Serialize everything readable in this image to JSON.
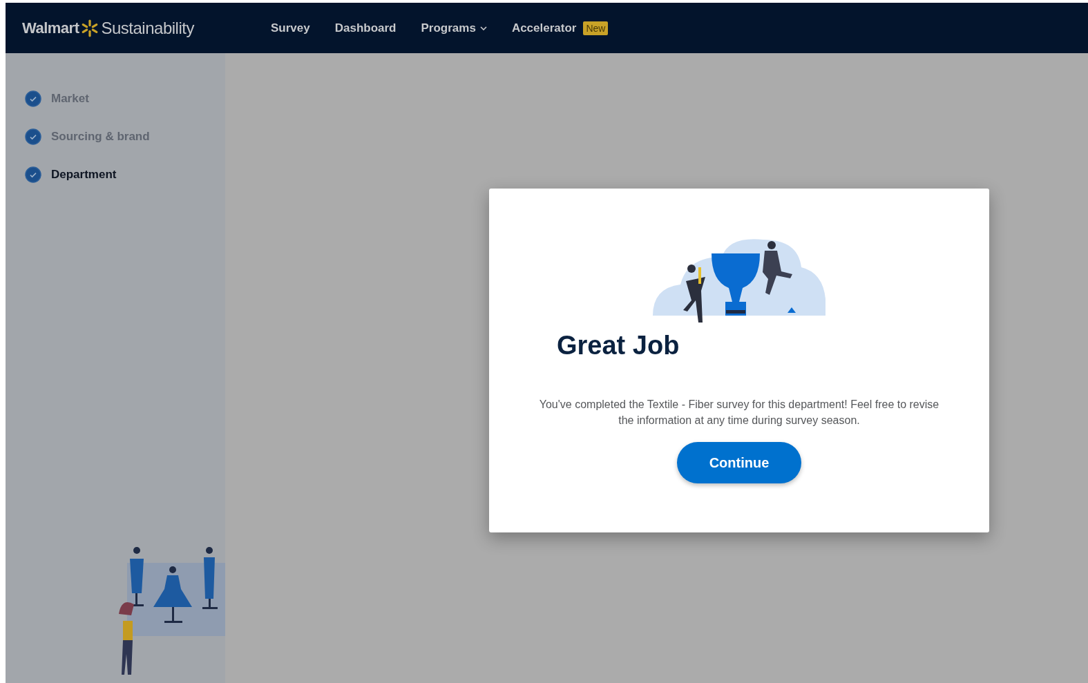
{
  "logo": {
    "brand": "Walmart",
    "product": "Sustainability"
  },
  "nav": [
    {
      "label": "Survey",
      "kind": "link"
    },
    {
      "label": "Dashboard",
      "kind": "link"
    },
    {
      "label": "Programs",
      "kind": "dropdown"
    },
    {
      "label": "Accelerator",
      "kind": "link",
      "badge": "New"
    }
  ],
  "steps": [
    {
      "label": "Market",
      "checked": true,
      "selected": false
    },
    {
      "label": "Sourcing & brand",
      "checked": true,
      "selected": false
    },
    {
      "label": "Department",
      "checked": true,
      "selected": true
    }
  ],
  "modal": {
    "title": "Great Job",
    "message": "You've completed the Textile - Fiber survey for this department! Feel free to revise the information at any time during survey season.",
    "button": "Continue"
  }
}
